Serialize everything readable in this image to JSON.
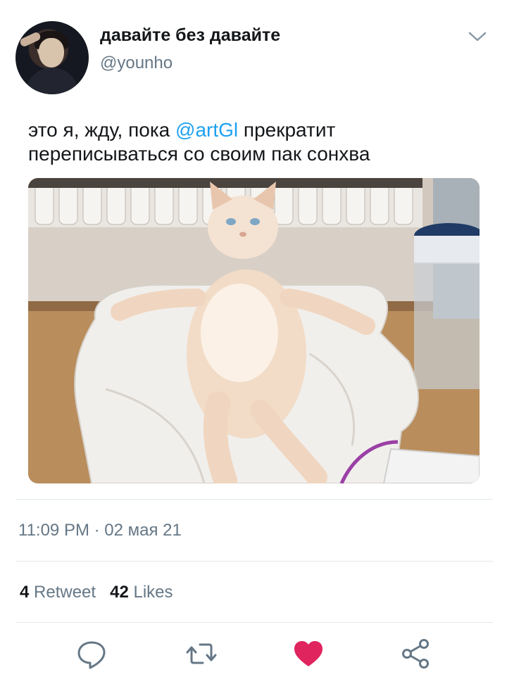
{
  "author": {
    "display_name": "давайте без давайте",
    "handle": "@younho"
  },
  "tweet": {
    "text_before": "это я, жду, пока ",
    "mention": "@artGl",
    "text_after": " прекратит переписываться со своим пак сонхва"
  },
  "meta": {
    "timestamp": "11:09 PM · 02 мая 21"
  },
  "stats": {
    "retweet_count": "4",
    "retweet_label": "Retweet",
    "like_count": "42",
    "like_label": "Likes"
  },
  "colors": {
    "link": "#1da1f2",
    "secondary_text": "#657786",
    "like_active": "#e0245e",
    "icon": "#657786"
  },
  "icons": {
    "menu": "chevron-down-icon",
    "reply": "speech-bubble-icon",
    "retweet": "retweet-arrows-icon",
    "like": "heart-icon",
    "share": "share-nodes-icon"
  }
}
